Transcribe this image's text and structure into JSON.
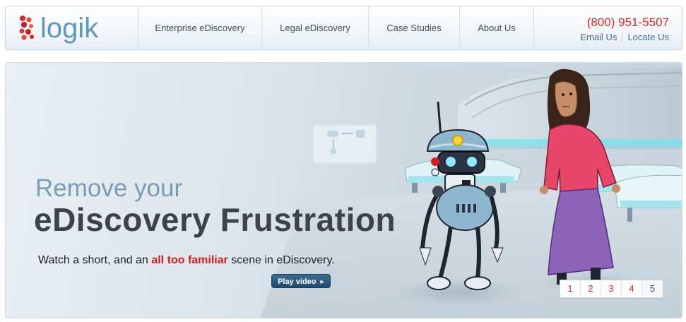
{
  "brand": {
    "name": "logik"
  },
  "nav": {
    "items": [
      {
        "label": "Enterprise eDiscovery"
      },
      {
        "label": "Legal eDiscovery"
      },
      {
        "label": "Case Studies"
      },
      {
        "label": "About Us"
      }
    ]
  },
  "contact": {
    "phone": "(800) 951-5507",
    "email_label": "Email Us",
    "locate_label": "Locate Us"
  },
  "hero": {
    "headline_1": "Remove your",
    "headline_2": "eDiscovery Frustration",
    "sub_before": "Watch a short, and an ",
    "sub_highlight": "all too familiar",
    "sub_after": " scene in eDiscovery.",
    "play_label": "Play video",
    "pager": [
      "1",
      "2",
      "3",
      "4",
      "5"
    ],
    "pager_active": "5"
  },
  "colors": {
    "accent_red": "#d82a2a",
    "logo_blue": "#5f98bd",
    "button_blue": "#2b587c"
  }
}
